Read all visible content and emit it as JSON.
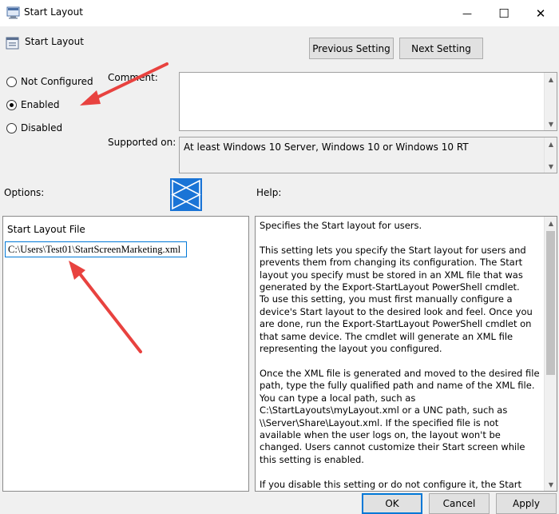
{
  "window": {
    "title": "Start Layout",
    "minimize_glyph": "—",
    "maximize_glyph": "☐",
    "close_glyph": "✕"
  },
  "setting": {
    "name": "Start Layout"
  },
  "nav": {
    "previous_label": "Previous Setting",
    "next_label": "Next Setting"
  },
  "state": {
    "options": [
      {
        "label": "Not Configured",
        "checked": false
      },
      {
        "label": "Enabled",
        "checked": true
      },
      {
        "label": "Disabled",
        "checked": false
      }
    ]
  },
  "comment": {
    "label": "Comment:",
    "value": ""
  },
  "supported": {
    "label": "Supported on:",
    "value": "At least Windows 10 Server, Windows 10 or Windows 10 RT"
  },
  "options_pane": {
    "label": "Options:",
    "field_label": "Start Layout File",
    "field_value": "C:\\Users\\Test01\\StartScreenMarketing.xml"
  },
  "help_pane": {
    "label": "Help:",
    "text": "Specifies the Start layout for users.\n\nThis setting lets you specify the Start layout for users and prevents them from changing its configuration. The Start layout you specify must be stored in an XML file that was generated by the Export-StartLayout PowerShell cmdlet.\nTo use this setting, you must first manually configure a device's Start layout to the desired look and feel. Once you are done, run the Export-StartLayout PowerShell cmdlet on that same device. The cmdlet will generate an XML file representing the layout you configured.\n\nOnce the XML file is generated and moved to the desired file path, type the fully qualified path and name of the XML file. You can type a local path, such as C:\\StartLayouts\\myLayout.xml or a UNC path, such as \\\\Server\\Share\\Layout.xml. If the specified file is not available when the user logs on, the layout won't be changed. Users cannot customize their Start screen while this setting is enabled.\n\nIf you disable this setting or do not configure it, the Start screen"
  },
  "footer": {
    "ok_label": "OK",
    "cancel_label": "Cancel",
    "apply_label": "Apply"
  },
  "colors": {
    "accent": "#0078d7",
    "annotation_arrow": "#e8423f"
  }
}
